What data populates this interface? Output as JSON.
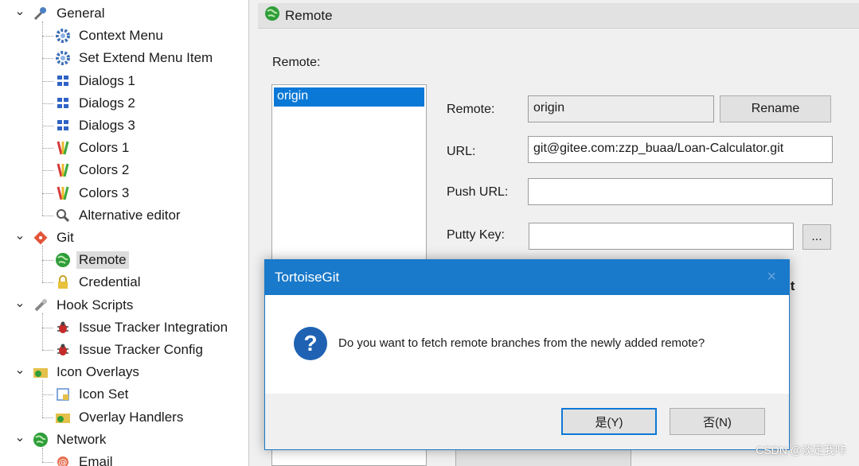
{
  "tree": {
    "items": [
      {
        "label": "General",
        "icon": "wrench-icon",
        "level": 0,
        "expanded": true
      },
      {
        "label": "Context Menu",
        "icon": "gear-icon",
        "level": 1
      },
      {
        "label": "Set Extend Menu Item",
        "icon": "gear-icon",
        "level": 1
      },
      {
        "label": "Dialogs 1",
        "icon": "dialogs-icon",
        "level": 1
      },
      {
        "label": "Dialogs 2",
        "icon": "dialogs-icon",
        "level": 1
      },
      {
        "label": "Dialogs 3",
        "icon": "dialogs-icon",
        "level": 1
      },
      {
        "label": "Colors 1",
        "icon": "colors-icon",
        "level": 1
      },
      {
        "label": "Colors 2",
        "icon": "colors-icon",
        "level": 1
      },
      {
        "label": "Colors 3",
        "icon": "colors-icon",
        "level": 1
      },
      {
        "label": "Alternative editor",
        "icon": "magnifier-icon",
        "level": 1
      },
      {
        "label": "Git",
        "icon": "git-icon",
        "level": 0,
        "expanded": true
      },
      {
        "label": "Remote",
        "icon": "globe-icon",
        "level": 1,
        "selected": true
      },
      {
        "label": "Credential",
        "icon": "lock-icon",
        "level": 1
      },
      {
        "label": "Hook Scripts",
        "icon": "hook-icon",
        "level": 0,
        "expanded": true
      },
      {
        "label": "Issue Tracker Integration",
        "icon": "bug-icon",
        "level": 1
      },
      {
        "label": "Issue Tracker Config",
        "icon": "bug-icon",
        "level": 1
      },
      {
        "label": "Icon Overlays",
        "icon": "overlay-icon",
        "level": 0,
        "expanded": true
      },
      {
        "label": "Icon Set",
        "icon": "iconset-icon",
        "level": 1
      },
      {
        "label": "Overlay Handlers",
        "icon": "overlay-icon",
        "level": 1
      },
      {
        "label": "Network",
        "icon": "globe-icon",
        "level": 0,
        "expanded": true
      },
      {
        "label": "Email",
        "icon": "email-icon",
        "level": 1
      }
    ]
  },
  "panel": {
    "title": "Remote",
    "title_icon": "globe-icon",
    "remote_list_label": "Remote:",
    "remotes": [
      "origin"
    ],
    "remote_label": "Remote:",
    "remote_value": "origin",
    "rename_button": "Rename",
    "url_label": "URL:",
    "url_value": "git@gitee.com:zzp_buaa/Loan-Calculator.git",
    "push_url_label": "Push URL:",
    "push_url_value": "",
    "putty_key_label": "Putty Key:",
    "putty_key_value": "",
    "browse_button": "...",
    "partial_label": "lt"
  },
  "dialog": {
    "title": "TortoiseGit",
    "close_glyph": "×",
    "icon": "question-icon",
    "icon_glyph": "?",
    "message": "Do you want to fetch remote branches from the newly added remote?",
    "yes_button": "是(Y)",
    "no_button": "否(N)"
  },
  "watermark": "CSDN @淡定我咔",
  "colors": {
    "accent": "#1979ca",
    "selection": "#0a78d7",
    "question_icon": "#1f62b3"
  }
}
